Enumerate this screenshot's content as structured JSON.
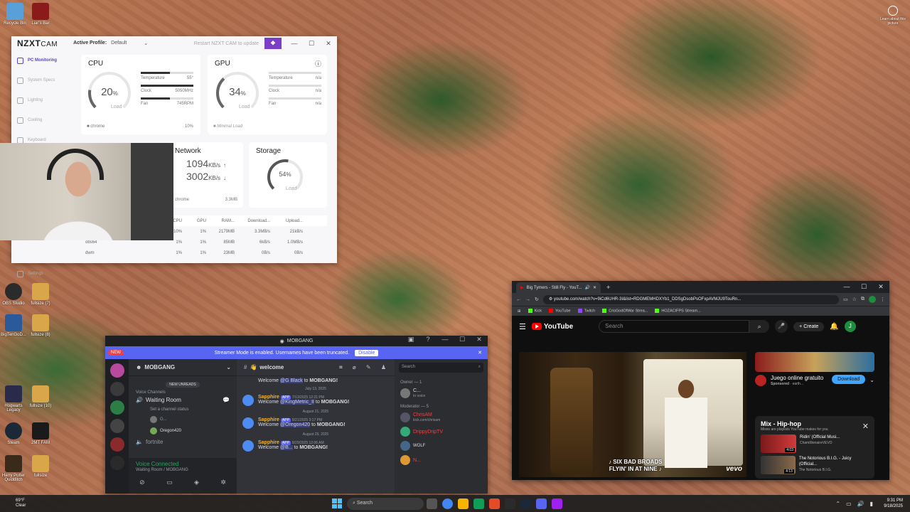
{
  "desktop": {
    "icons": [
      {
        "label": "Recycle Bin",
        "color": "#5aa0d8"
      },
      {
        "label": "Liar's Bar",
        "color": "#8b1a1a"
      },
      {
        "label": "OBS Studio",
        "color": "#2b2b2b"
      },
      {
        "label": "fullsize (7)",
        "color": "#d9a64a"
      },
      {
        "label": "BigTenGoD...",
        "color": "#2b5a9a"
      },
      {
        "label": "fullsize (8)",
        "color": "#d9a64a"
      },
      {
        "label": "2MT FAM",
        "color": "#1a1a1a"
      },
      {
        "label": "fullsize",
        "color": "#d9a64a"
      },
      {
        "label": "Steam",
        "color": "#1b2838"
      },
      {
        "label": "Harry Potter Quidditch",
        "color": "#3a2a1a"
      },
      {
        "label": "Hogwarts Legacy",
        "color": "#2a2a4a"
      },
      {
        "label": "fullsize (10)",
        "color": "#d9a64a"
      }
    ],
    "learn_about": "Learn about this picture"
  },
  "nzxt": {
    "brand": "NZXT",
    "brand_sub": "CAM",
    "active_profile_label": "Active Profile:",
    "active_profile_value": "Default",
    "restart_text": "Restart NZXT CAM to update",
    "sidebar": [
      "PC Monitoring",
      "System Specs",
      "Lighting",
      "Cooling",
      "Keyboard",
      "Settings"
    ],
    "cpu": {
      "title": "CPU",
      "load": "20",
      "load_pct": 20,
      "unit": "%",
      "load_label": "Load",
      "temp_label": "Temperature",
      "temp_value": "55°",
      "clock_label": "Clock",
      "clock_value": "5050MHz",
      "fan_label": "Fan",
      "fan_value": "745RPM",
      "top_process": "chrome",
      "top_process_value": "10%"
    },
    "gpu": {
      "title": "GPU",
      "load": "34",
      "load_pct": 34,
      "unit": "%",
      "load_label": "Load",
      "temp_label": "Temperature",
      "temp_value": "n/a",
      "clock_label": "Clock",
      "clock_value": "n/a",
      "fan_label": "Fan",
      "fan_value": "n/a",
      "footer": "Minimal Load"
    },
    "network": {
      "title": "Network",
      "down": "1094",
      "up": "3002",
      "unit": "KB/s",
      "top_process": "chrome",
      "top_value": "3.3MB"
    },
    "storage": {
      "title": "Storage",
      "load": "54",
      "load_pct": 54,
      "unit": "%",
      "load_label": "Load"
    },
    "table": {
      "headers": [
        "CPU",
        "GPU",
        "RAM...",
        "Download...",
        "Upload..."
      ],
      "rows": [
        {
          "name": "",
          "cpu": "10%",
          "gpu": "1%",
          "ram": "2179MB",
          "down": "3.3MB/s",
          "up": "21kB/s"
        },
        {
          "name": "obs64",
          "cpu": "1%",
          "gpu": "1%",
          "ram": "85MB",
          "down": "6kB/s",
          "up": "1.0MB/s"
        },
        {
          "name": "dwm",
          "cpu": "1%",
          "gpu": "1%",
          "ram": "23MB",
          "down": "0B/s",
          "up": "0B/s"
        }
      ]
    }
  },
  "discord": {
    "title": "MOBGANG",
    "banner_text": "Streamer Mode is enabled. Usernames have been truncated.",
    "banner_button": "Disable",
    "new_badge": "NEW",
    "server_name": "MOBGANG",
    "new_unreads": "NEW UNREADS",
    "voice_channels_label": "Voice Channels",
    "channel_waiting_room": "Waiting Room",
    "channel_status": "Set a channel status",
    "user_1": "G...",
    "user_2": "Oregon420",
    "channel_fortnite": "fortnite",
    "voice_connected": "Voice Connected",
    "voice_room": "Waiting Room / MOBGANG",
    "chat_channel": "welcome",
    "messages": [
      {
        "name": "",
        "app": "",
        "time": "",
        "text": "Welcome ",
        "mention": "@G Black",
        "suffix": " to ",
        "server": "MOBGANG!"
      },
      {
        "date": "July 13, 2025"
      },
      {
        "name": "Sapphire",
        "app": "APP",
        "time": "7/13/2025 12:21 PM",
        "text": "Welcome ",
        "mention": "@KingMetric_II",
        "suffix": " to ",
        "server": "MOBGANG!"
      },
      {
        "date": "August 21, 2025"
      },
      {
        "name": "Sapphire",
        "app": "APP",
        "time": "8/21/2025 3:17 PM",
        "text": "Welcome ",
        "mention": "@Oregon420",
        "suffix": " to ",
        "server": "MOBGANG!"
      },
      {
        "date": "August 29, 2025"
      },
      {
        "name": "Sapphire",
        "app": "APP",
        "time": "8/29/2025 12:06 AM",
        "text": "Welcome ",
        "mention": "@B...",
        "suffix": " to ",
        "server": "MOBGANG!"
      }
    ],
    "search_placeholder": "Search",
    "owner_label": "Owner — 1",
    "owner_name": "C...",
    "owner_status": "In voice",
    "moderator_label": "Moderator — 5",
    "moderators": [
      {
        "name": "ChrisAM",
        "sub": "kick.com/chrisam",
        "color": "#f23f43"
      },
      {
        "name": "DrippyDripTV",
        "sub": "",
        "color": "#f23f43"
      },
      {
        "name": "WOLF",
        "sub": "",
        "color": "#dbdee1"
      },
      {
        "name": "N...",
        "sub": "",
        "color": "#f23f43"
      }
    ]
  },
  "chrome": {
    "tab_title": "Big Tymers - Still Fly - YouT...",
    "url": "youtube.com/watch?v=9iCd6UHR-3I&list=RDGMEMHDXYb1_DDSgDsobPsOFxpAVMJU9TouRn...",
    "bookmarks": [
      {
        "label": "Kick",
        "color": "#53fc18"
      },
      {
        "label": "YouTube",
        "color": "#ff0000"
      },
      {
        "label": "Twitch",
        "color": "#9146ff"
      },
      {
        "label": "CrisGodOfWar Strea...",
        "color": "#53fc18"
      },
      {
        "label": "HOZACIFPS Stream...",
        "color": "#53fc18"
      }
    ],
    "yt_logo": "YouTube",
    "yt_search_placeholder": "Search",
    "yt_create": "Create",
    "yt_avatar": "J",
    "video_caption_1": "♪ SIX BAD BROADS",
    "video_caption_2": "FLYIN' IN AT NINE ♪",
    "video_watermark": "vevo",
    "ad_title": "Juego online gratuito",
    "ad_sponsored": "Sponsored",
    "ad_domain": "· earth...",
    "ad_button": "Download",
    "mix_title": "Mix - Hip-hop",
    "mix_sub": "Mixes are playlists YouTube makes for you",
    "mix_items": [
      {
        "title": "Ridin' (Official Musi...",
        "channel": "ChamillionaireVEVO",
        "duration": "4:03"
      },
      {
        "title": "The Notorious B.I.G. - Juicy (Official...",
        "channel": "The Notorious B.I.G.",
        "duration": "4:13"
      }
    ]
  },
  "taskbar": {
    "weather_temp": "69°F",
    "weather_desc": "Clear",
    "search": "Search",
    "time": "9:31 PM",
    "date": "9/18/2025",
    "app_colors": [
      "#555",
      "#4285f4",
      "#f4b400",
      "#0f9d58",
      "#e34c26",
      "#2b2b2b",
      "#1b2838",
      "#5865f2",
      "#a020f0"
    ]
  }
}
